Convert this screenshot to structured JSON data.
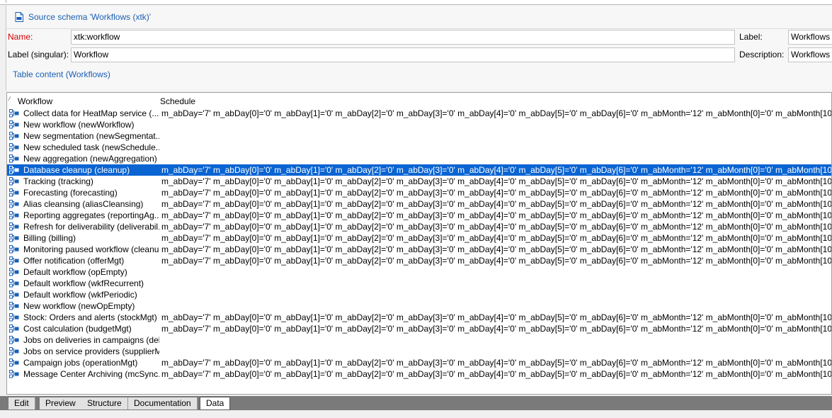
{
  "header": {
    "title": "Source schema 'Workflows (xtk)'",
    "icon": "xml-file-icon"
  },
  "form": {
    "name_label": "Name:",
    "name_value": "xtk:workflow",
    "label_label": "Label:",
    "label_value": "Workflows",
    "singular_label": "Label (singular):",
    "singular_value": "Workflow",
    "description_label": "Description:",
    "description_value": "Workflows c"
  },
  "table_link": "Table content (Workflows)",
  "grid": {
    "columns": [
      "Workflow",
      "Schedule"
    ],
    "rows": [
      {
        "workflow": "Collect data for HeatMap service (...",
        "schedule": "m_abDay='7' m_abDay[0]='0' m_abDay[1]='0' m_abDay[2]='0' m_abDay[3]='0' m_abDay[4]='0' m_abDay[5]='0' m_abDay[6]='0' m_abMonth='12' m_abMonth[0]='0' m_abMonth[10"
      },
      {
        "workflow": "New workflow (newWorkflow)",
        "schedule": ""
      },
      {
        "workflow": "New segmentation (newSegmentat...",
        "schedule": ""
      },
      {
        "workflow": "New scheduled task (newSchedule...",
        "schedule": ""
      },
      {
        "workflow": "New aggregation (newAggregation)",
        "schedule": ""
      },
      {
        "workflow": "Database cleanup (cleanup)",
        "schedule": "m_abDay='7' m_abDay[0]='0' m_abDay[1]='0' m_abDay[2]='0' m_abDay[3]='0' m_abDay[4]='0' m_abDay[5]='0' m_abDay[6]='0' m_abMonth='12' m_abMonth[0]='0' m_abMonth[10",
        "selected": true
      },
      {
        "workflow": "Tracking (tracking)",
        "schedule": "m_abDay='7' m_abDay[0]='0' m_abDay[1]='0' m_abDay[2]='0' m_abDay[3]='0' m_abDay[4]='0' m_abDay[5]='0' m_abDay[6]='0' m_abMonth='12' m_abMonth[0]='0' m_abMonth[10"
      },
      {
        "workflow": "Forecasting (forecasting)",
        "schedule": "m_abDay='7' m_abDay[0]='0' m_abDay[1]='0' m_abDay[2]='0' m_abDay[3]='0' m_abDay[4]='0' m_abDay[5]='0' m_abDay[6]='0' m_abMonth='12' m_abMonth[0]='0' m_abMonth[10"
      },
      {
        "workflow": "Alias cleansing (aliasCleansing)",
        "schedule": "m_abDay='7' m_abDay[0]='0' m_abDay[1]='0' m_abDay[2]='0' m_abDay[3]='0' m_abDay[4]='0' m_abDay[5]='0' m_abDay[6]='0' m_abMonth='12' m_abMonth[0]='0' m_abMonth[10"
      },
      {
        "workflow": "Reporting aggregates (reportingAg...",
        "schedule": "m_abDay='7' m_abDay[0]='0' m_abDay[1]='0' m_abDay[2]='0' m_abDay[3]='0' m_abDay[4]='0' m_abDay[5]='0' m_abDay[6]='0' m_abMonth='12' m_abMonth[0]='0' m_abMonth[10"
      },
      {
        "workflow": "Refresh for deliverability (deliverabil...",
        "schedule": "m_abDay='7' m_abDay[0]='0' m_abDay[1]='0' m_abDay[2]='0' m_abDay[3]='0' m_abDay[4]='0' m_abDay[5]='0' m_abDay[6]='0' m_abMonth='12' m_abMonth[0]='0' m_abMonth[10"
      },
      {
        "workflow": "Billing (billing)",
        "schedule": "m_abDay='7' m_abDay[0]='0' m_abDay[1]='0' m_abDay[2]='0' m_abDay[3]='0' m_abDay[4]='0' m_abDay[5]='0' m_abDay[6]='0' m_abMonth='12' m_abMonth[0]='0' m_abMonth[10"
      },
      {
        "workflow": "Monitoring paused workflow (cleanu...",
        "schedule": "m_abDay='7' m_abDay[0]='0' m_abDay[1]='0' m_abDay[2]='0' m_abDay[3]='0' m_abDay[4]='0' m_abDay[5]='0' m_abDay[6]='0' m_abMonth='12' m_abMonth[0]='0' m_abMonth[10"
      },
      {
        "workflow": "Offer notification (offerMgt)",
        "schedule": "m_abDay='7' m_abDay[0]='0' m_abDay[1]='0' m_abDay[2]='0' m_abDay[3]='0' m_abDay[4]='0' m_abDay[5]='0' m_abDay[6]='0' m_abMonth='12' m_abMonth[0]='0' m_abMonth[10"
      },
      {
        "workflow": "Default workflow (opEmpty)",
        "schedule": ""
      },
      {
        "workflow": "Default workflow (wkfRecurrent)",
        "schedule": ""
      },
      {
        "workflow": "Default workflow (wkfPeriodic)",
        "schedule": ""
      },
      {
        "workflow": "New workflow (newOpEmpty)",
        "schedule": ""
      },
      {
        "workflow": "Stock: Orders and alerts (stockMgt)",
        "schedule": "m_abDay='7' m_abDay[0]='0' m_abDay[1]='0' m_abDay[2]='0' m_abDay[3]='0' m_abDay[4]='0' m_abDay[5]='0' m_abDay[6]='0' m_abMonth='12' m_abMonth[0]='0' m_abMonth[10"
      },
      {
        "workflow": "Cost calculation (budgetMgt)",
        "schedule": "m_abDay='7' m_abDay[0]='0' m_abDay[1]='0' m_abDay[2]='0' m_abDay[3]='0' m_abDay[4]='0' m_abDay[5]='0' m_abDay[6]='0' m_abMonth='12' m_abMonth[0]='0' m_abMonth[10"
      },
      {
        "workflow": "Jobs on deliveries in campaigns (del...",
        "schedule": ""
      },
      {
        "workflow": "Jobs on service providers (supplierM...",
        "schedule": ""
      },
      {
        "workflow": "Campaign jobs (operationMgt)",
        "schedule": "m_abDay='7' m_abDay[0]='0' m_abDay[1]='0' m_abDay[2]='0' m_abDay[3]='0' m_abDay[4]='0' m_abDay[5]='0' m_abDay[6]='0' m_abMonth='12' m_abMonth[0]='0' m_abMonth[10"
      },
      {
        "workflow": "Message Center Archiving (mcSync...",
        "schedule": "m_abDay='7' m_abDay[0]='0' m_abDay[1]='0' m_abDay[2]='0' m_abDay[3]='0' m_abDay[4]='0' m_abDay[5]='0' m_abDay[6]='0' m_abMonth='12' m_abMonth[0]='0' m_abMonth[10"
      }
    ]
  },
  "tabs": [
    {
      "label": "Edit"
    },
    {
      "label": "Preview"
    },
    {
      "label": "Structure"
    },
    {
      "label": "Documentation"
    },
    {
      "label": "Data",
      "active": true
    }
  ],
  "colors": {
    "accent": "#1a5fb4",
    "selection": "#0a64d2",
    "required": "#d40000"
  }
}
